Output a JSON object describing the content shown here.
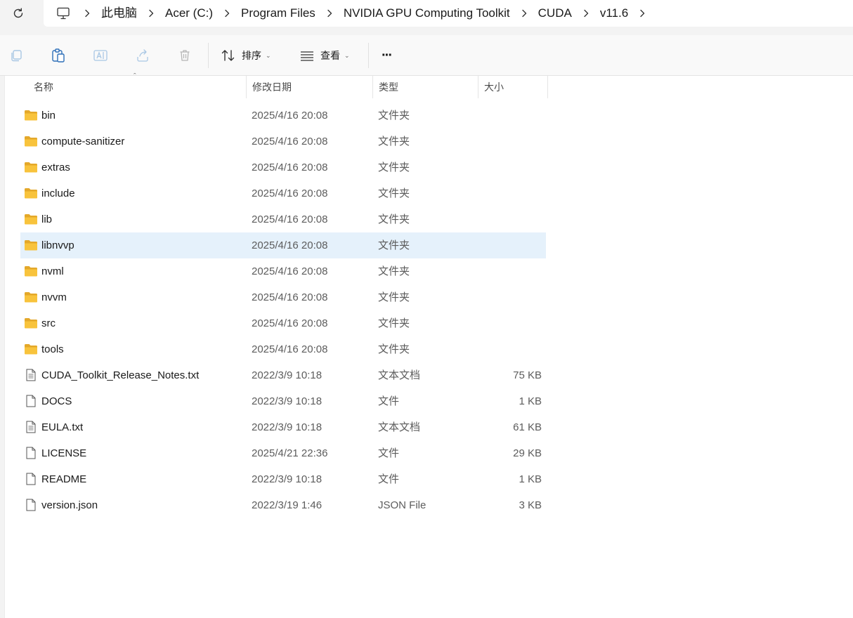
{
  "address": {
    "refresh_icon": "refresh-icon",
    "root_icon": "computer-icon",
    "crumbs": [
      "此电脑",
      "Acer (C:)",
      "Program Files",
      "NVIDIA GPU Computing Toolkit",
      "CUDA",
      "v11.6"
    ]
  },
  "toolbar": {
    "sort_label": "排序",
    "view_label": "查看",
    "more_label": "···"
  },
  "columns": {
    "name": "名称",
    "modified": "修改日期",
    "type": "类型",
    "size": "大小"
  },
  "files": [
    {
      "name": "bin",
      "modified": "2025/4/16 20:08",
      "type": "文件夹",
      "size": "",
      "kind": "folder"
    },
    {
      "name": "compute-sanitizer",
      "modified": "2025/4/16 20:08",
      "type": "文件夹",
      "size": "",
      "kind": "folder"
    },
    {
      "name": "extras",
      "modified": "2025/4/16 20:08",
      "type": "文件夹",
      "size": "",
      "kind": "folder"
    },
    {
      "name": "include",
      "modified": "2025/4/16 20:08",
      "type": "文件夹",
      "size": "",
      "kind": "folder"
    },
    {
      "name": "lib",
      "modified": "2025/4/16 20:08",
      "type": "文件夹",
      "size": "",
      "kind": "folder"
    },
    {
      "name": "libnvvp",
      "modified": "2025/4/16 20:08",
      "type": "文件夹",
      "size": "",
      "kind": "folder",
      "selected": true
    },
    {
      "name": "nvml",
      "modified": "2025/4/16 20:08",
      "type": "文件夹",
      "size": "",
      "kind": "folder"
    },
    {
      "name": "nvvm",
      "modified": "2025/4/16 20:08",
      "type": "文件夹",
      "size": "",
      "kind": "folder"
    },
    {
      "name": "src",
      "modified": "2025/4/16 20:08",
      "type": "文件夹",
      "size": "",
      "kind": "folder"
    },
    {
      "name": "tools",
      "modified": "2025/4/16 20:08",
      "type": "文件夹",
      "size": "",
      "kind": "folder"
    },
    {
      "name": "CUDA_Toolkit_Release_Notes.txt",
      "modified": "2022/3/9 10:18",
      "type": "文本文档",
      "size": "75 KB",
      "kind": "text"
    },
    {
      "name": "DOCS",
      "modified": "2022/3/9 10:18",
      "type": "文件",
      "size": "1 KB",
      "kind": "file"
    },
    {
      "name": "EULA.txt",
      "modified": "2022/3/9 10:18",
      "type": "文本文档",
      "size": "61 KB",
      "kind": "text"
    },
    {
      "name": "LICENSE",
      "modified": "2025/4/21 22:36",
      "type": "文件",
      "size": "29 KB",
      "kind": "file"
    },
    {
      "name": "README",
      "modified": "2022/3/9 10:18",
      "type": "文件",
      "size": "1 KB",
      "kind": "file"
    },
    {
      "name": "version.json",
      "modified": "2022/3/19 1:46",
      "type": "JSON File",
      "size": "3 KB",
      "kind": "file"
    }
  ],
  "colors": {
    "folder": "#f8c33c",
    "folder_dark": "#e4a82a",
    "selected_row": "#e5f1fb"
  }
}
